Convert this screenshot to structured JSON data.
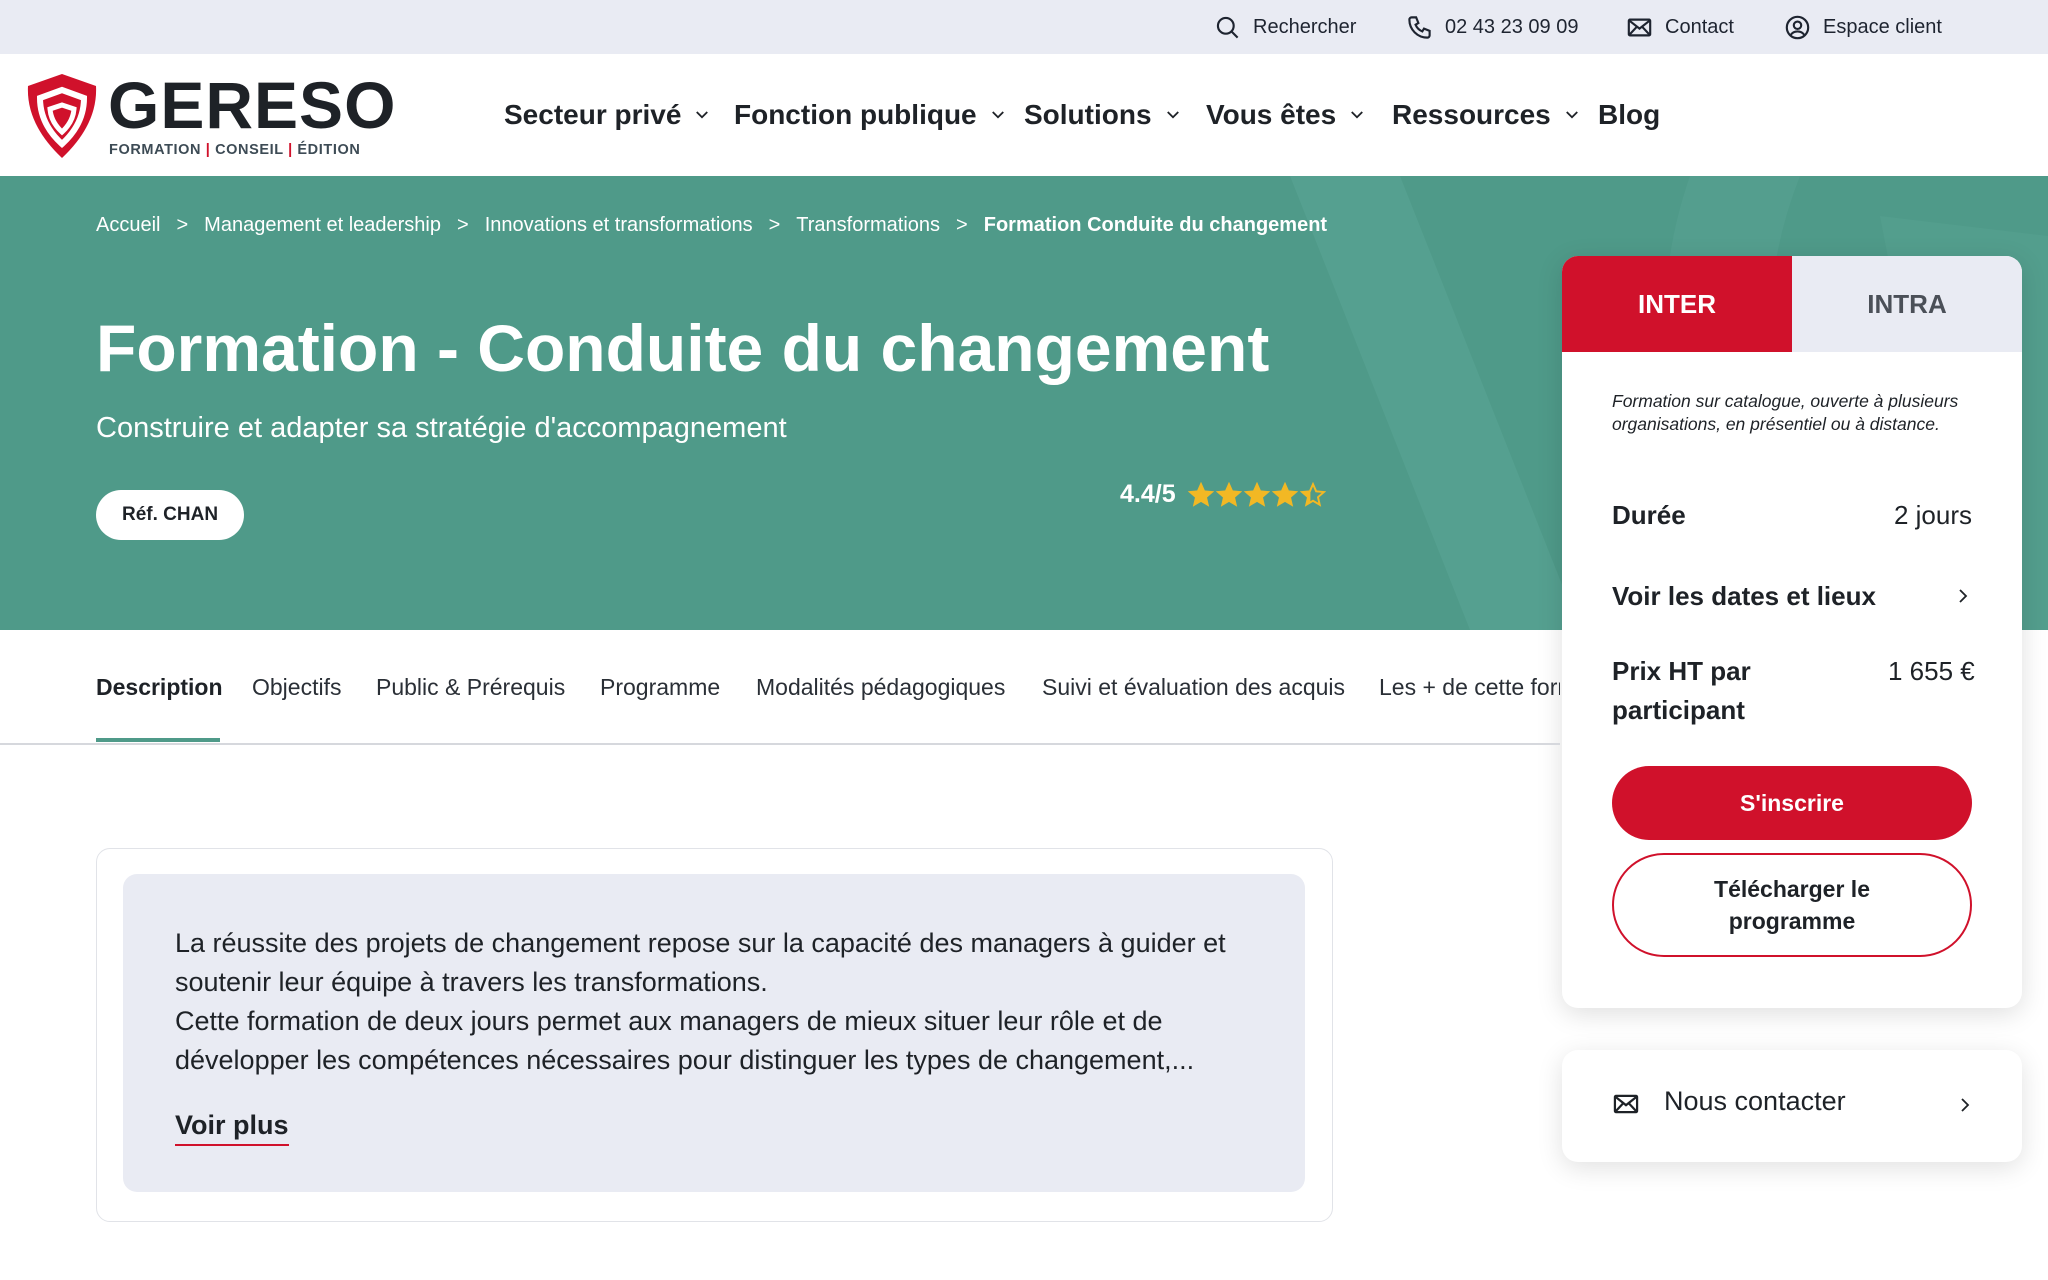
{
  "topbar": {
    "search_label": "Rechercher",
    "phone_label": "02 43 23 09 09",
    "contact_label": "Contact",
    "account_label": "Espace client"
  },
  "logo": {
    "word": "GERESO",
    "sub_1": "FORMATION",
    "sub_2": "CONSEIL",
    "sub_3": "ÉDITION"
  },
  "nav": {
    "items": [
      {
        "label": "Secteur privé"
      },
      {
        "label": "Fonction publique"
      },
      {
        "label": "Solutions"
      },
      {
        "label": "Vous êtes"
      },
      {
        "label": "Ressources"
      },
      {
        "label": "Blog"
      }
    ]
  },
  "breadcrumb": {
    "items": [
      {
        "label": "Accueil"
      },
      {
        "label": "Management et leadership"
      },
      {
        "label": "Innovations et transformations"
      },
      {
        "label": "Transformations"
      },
      {
        "label": "Formation Conduite du changement"
      }
    ],
    "separator": ">"
  },
  "hero": {
    "title": "Formation - Conduite du changement",
    "subtitle": "Construire et adapter sa stratégie d'accompagnement",
    "ref_label": "Réf. CHAN",
    "rating_text": "4.4/5",
    "rating_value": 4.4,
    "rating_max": 5,
    "star_color": "#f2b824"
  },
  "tabs": {
    "items": [
      {
        "label": "Description"
      },
      {
        "label": "Objectifs"
      },
      {
        "label": "Public & Prérequis"
      },
      {
        "label": "Programme"
      },
      {
        "label": "Modalités pédagogiques"
      },
      {
        "label": "Suivi et évaluation des acquis"
      },
      {
        "label": "Les + de cette formation"
      }
    ]
  },
  "description": {
    "line_1": "La réussite des projets de changement repose sur la capacité des managers à guider et",
    "line_2": "soutenir leur équipe à travers les transformations.",
    "line_3": "Cette formation de deux jours permet aux managers de mieux situer leur rôle et de",
    "line_4": "développer les compétences nécessaires pour distinguer les types de changement,...",
    "more_label": "Voir plus"
  },
  "booking": {
    "tab_inter": "INTER",
    "tab_intra": "INTRA",
    "note": "Formation sur catalogue, ouverte à plusieurs organisations, en présentiel ou à distance.",
    "duration_label": "Durée",
    "duration_value": "2 jours",
    "dates_label": "Voir les dates et lieux",
    "price_label": "Prix HT par participant",
    "price_value": "1 655 €",
    "subscribe_label": "S'inscrire",
    "download_label": "Télécharger le programme"
  },
  "contact_card": {
    "label": "Nous contacter"
  },
  "colors": {
    "brand_red": "#d0112b",
    "hero_green": "#4f9a89",
    "topbar_bg": "#e9ebf3"
  }
}
